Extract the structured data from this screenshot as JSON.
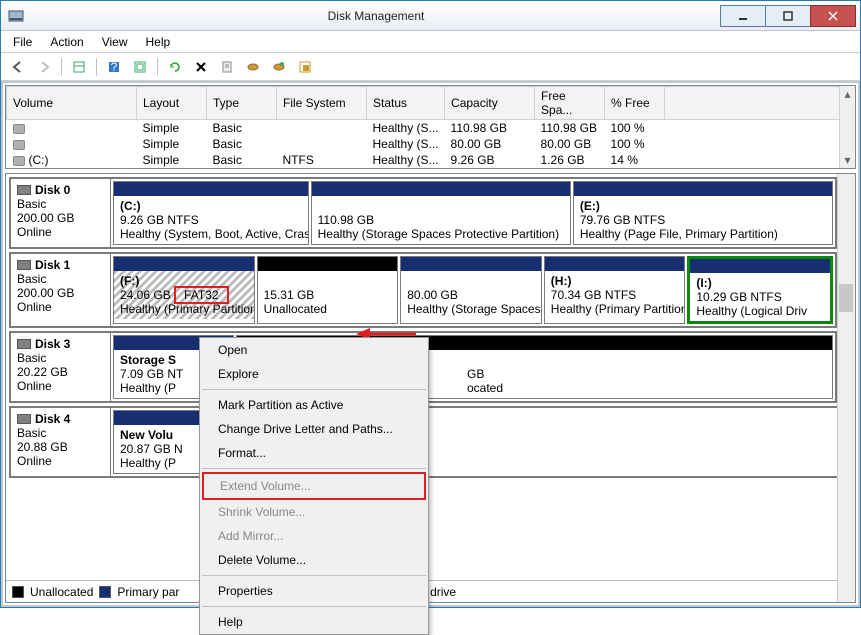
{
  "window": {
    "title": "Disk Management"
  },
  "menu": {
    "file": "File",
    "action": "Action",
    "view": "View",
    "help": "Help"
  },
  "volumes": {
    "headers": {
      "volume": "Volume",
      "layout": "Layout",
      "type": "Type",
      "filesystem": "File System",
      "status": "Status",
      "capacity": "Capacity",
      "freespace": "Free Spa...",
      "pctfree": "% Free"
    },
    "rows": [
      {
        "vol": "",
        "layout": "Simple",
        "type": "Basic",
        "fs": "",
        "status": "Healthy (S...",
        "cap": "110.98 GB",
        "free": "110.98 GB",
        "pct": "100 %"
      },
      {
        "vol": "",
        "layout": "Simple",
        "type": "Basic",
        "fs": "",
        "status": "Healthy (S...",
        "cap": "80.00 GB",
        "free": "80.00 GB",
        "pct": "100 %"
      },
      {
        "vol": "(C:)",
        "layout": "Simple",
        "type": "Basic",
        "fs": "NTFS",
        "status": "Healthy (S...",
        "cap": "9.26 GB",
        "free": "1.26 GB",
        "pct": "14 %"
      }
    ]
  },
  "disks": [
    {
      "name": "Disk 0",
      "type": "Basic",
      "size": "200.00 GB",
      "state": "Online",
      "parts": [
        {
          "title": "(C:)",
          "line2": "9.26 GB NTFS",
          "line3": "Healthy (System, Boot, Active, Crash",
          "top": "blue",
          "flex": 3
        },
        {
          "title": "",
          "line2": "110.98 GB",
          "line3": "Healthy (Storage Spaces Protective Partition)",
          "top": "blue",
          "flex": 4
        },
        {
          "title": "(E:)",
          "line2": "79.76 GB NTFS",
          "line3": "Healthy (Page File, Primary Partition)",
          "top": "blue",
          "flex": 4
        }
      ]
    },
    {
      "name": "Disk 1",
      "type": "Basic",
      "size": "200.00 GB",
      "state": "Online",
      "parts": [
        {
          "title": "(F:)",
          "line2a": "24.06 GB",
          "line2b": "FAT32",
          "line3": "Healthy (Primary Partition)",
          "top": "blue",
          "flex": 2,
          "hatch": true,
          "fatbox": true
        },
        {
          "title": "",
          "line2": "15.31 GB",
          "line3": "Unallocated",
          "top": "black",
          "flex": 2
        },
        {
          "title": "",
          "line2": "80.00 GB",
          "line3": "Healthy (Storage Spaces Pr",
          "top": "blue",
          "flex": 2
        },
        {
          "title": "(H:)",
          "line2": "70.34 GB NTFS",
          "line3": "Healthy (Primary Partition)",
          "top": "blue",
          "flex": 2
        },
        {
          "title": "(I:)",
          "line2": "10.29 GB NTFS",
          "line3": "Healthy (Logical Driv",
          "top": "blue",
          "flex": 2,
          "green": true
        }
      ]
    },
    {
      "name": "Disk 3",
      "type": "Basic",
      "size": "20.22 GB",
      "state": "Online",
      "parts": [
        {
          "title": "Storage S",
          "line2": "7.09 GB NT",
          "line3": "Healthy (P",
          "top": "blue",
          "flex": 1
        },
        {
          "title": "",
          "line2": "GB",
          "line3": "ocated",
          "top": "black",
          "flex": 5,
          "pad": true
        }
      ]
    },
    {
      "name": "Disk 4",
      "type": "Basic",
      "size": "20.88 GB",
      "state": "Online",
      "parts": [
        {
          "title": "New Volu",
          "line2": "20.87 GB N",
          "line3": "Healthy (P",
          "top": "blue",
          "flex": 1
        }
      ]
    }
  ],
  "legend": {
    "unalloc": "Unallocated",
    "primary": "Primary par",
    "logical": "ogical drive"
  },
  "ctx": {
    "open": "Open",
    "explore": "Explore",
    "mark": "Mark Partition as Active",
    "change": "Change Drive Letter and Paths...",
    "format": "Format...",
    "extend": "Extend Volume...",
    "shrink": "Shrink Volume...",
    "mirror": "Add Mirror...",
    "delete": "Delete Volume...",
    "props": "Properties",
    "help": "Help"
  }
}
